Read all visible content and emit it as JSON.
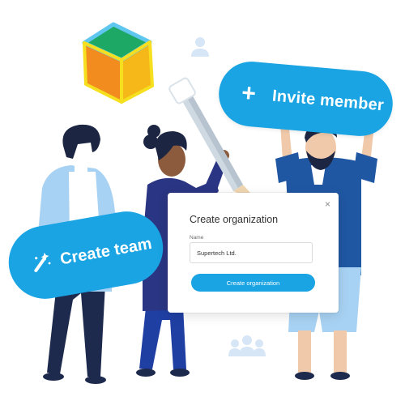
{
  "invite_pill": {
    "icon": "plus-icon",
    "plus_glyph": "+",
    "label": "Invite member"
  },
  "team_pill": {
    "icon": "magic-wand-icon",
    "label": "Create team"
  },
  "modal": {
    "title": "Create organization",
    "close_glyph": "×",
    "field_label": "Name",
    "field_value": "Supertech Ltd.",
    "submit_label": "Create organization"
  },
  "decor": {
    "cube_icon": "cube-logo-icon",
    "user_icon": "user-icon",
    "group_icon": "group-icon",
    "pencil_icon": "pencil-icon"
  },
  "colors": {
    "accent": "#1aa4e3",
    "navy": "#1d2a4d",
    "light_blue": "#a8d2f3",
    "hair_dark": "#1c2642"
  }
}
